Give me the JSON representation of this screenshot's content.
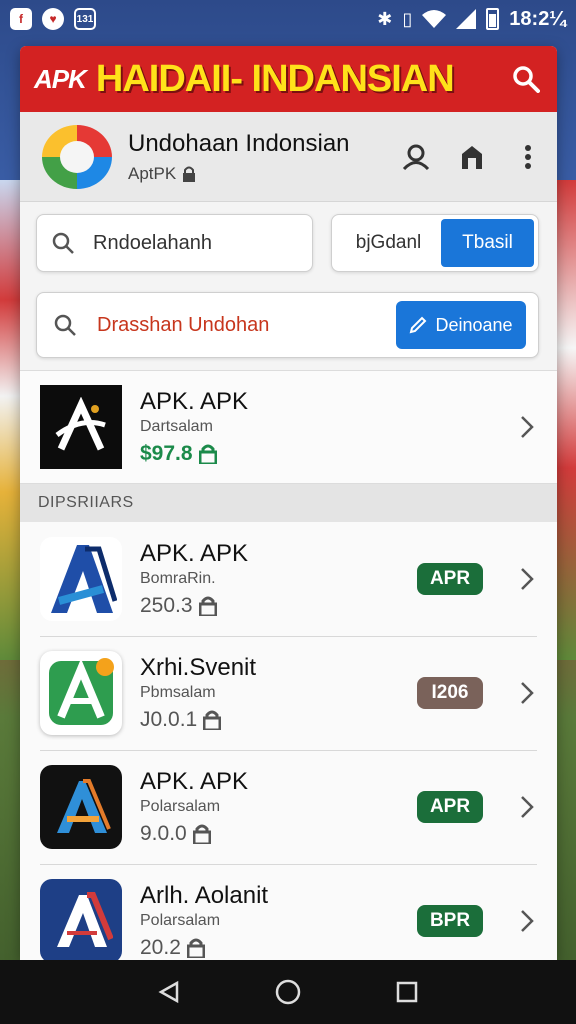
{
  "status_bar": {
    "left_icons": [
      "facebook-icon",
      "notification-icon",
      "calendar-icon"
    ],
    "calendar_badge": "131",
    "time": "18:2¼",
    "right_icons": [
      "bluetooth-icon",
      "vibrate-icon",
      "wifi-icon",
      "signal-icon",
      "battery-icon"
    ]
  },
  "banner": {
    "apk_label": "APK",
    "title": "HAIDAII- INDANSIAN",
    "bg_color": "#d32222",
    "title_color": "#ffe21a"
  },
  "header": {
    "title": "Undohaan Indonsian",
    "subtitle": "AptPK",
    "icons": [
      "user-icon",
      "store-icon",
      "more-vertical-icon"
    ]
  },
  "search": {
    "value": "Rndoelahanh",
    "segment_left": "bjGdanl",
    "segment_right": "Tbasil"
  },
  "filter": {
    "value": "Drasshan Undohan",
    "button_label": "Deinoane"
  },
  "featured": {
    "name": "APK. APK",
    "developer": "Dartsalam",
    "price": "$97.8"
  },
  "section_label": "DIPSRIIARS",
  "apps": [
    {
      "name": "APK. APK",
      "developer": "BomraRin.",
      "price": "250.3",
      "badge": "APR",
      "badge_color": "#1b6e3a"
    },
    {
      "name": "Xrhi.Svenit",
      "developer": "Pbmsalam",
      "price": "J0.0.1",
      "badge": "I206",
      "badge_color": "#7a625a"
    },
    {
      "name": "APK. APK",
      "developer": "Polarsalam",
      "price": "9.0.0",
      "badge": "APR",
      "badge_color": "#1b6e3a"
    },
    {
      "name": "Arlh. Aolanit",
      "developer": "Polarsalam",
      "price": "20.2",
      "badge": "BPR",
      "badge_color": "#1b6e3a"
    }
  ],
  "nav": {
    "buttons": [
      "back-icon",
      "home-icon",
      "recents-icon"
    ]
  },
  "colors": {
    "accent_blue": "#1a76d9",
    "price_green": "#1b8a4a"
  }
}
